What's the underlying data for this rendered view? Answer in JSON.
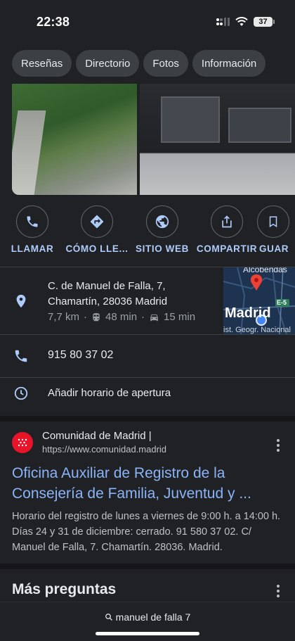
{
  "status": {
    "time": "22:38",
    "battery": "37"
  },
  "chips": [
    "Reseñas",
    "Directorio",
    "Fotos",
    "Información"
  ],
  "actions": [
    {
      "label": "LLAMAR",
      "icon": "phone-icon"
    },
    {
      "label": "CÓMO LLE...",
      "icon": "directions-icon"
    },
    {
      "label": "SITIO WEB",
      "icon": "globe-icon"
    },
    {
      "label": "COMPARTIR",
      "icon": "share-icon"
    },
    {
      "label": "GUAR",
      "icon": "bookmark-icon"
    }
  ],
  "address": {
    "line1": "C. de Manuel de Falla, 7,",
    "line2": "Chamartín, 28036 Madrid",
    "distance": "7,7 km",
    "transit_time": "48 min",
    "drive_time": "15 min"
  },
  "map": {
    "city_label": "Madrid",
    "top_label": "Alcobendas",
    "road_label": "E-5",
    "bottom_label": "ist. Geogr. Nacional"
  },
  "phone": "915 80 37 02",
  "hours_prompt": "Añadir horario de apertura",
  "result": {
    "source_name": "Comunidad de Madrid |",
    "source_url": "https://www.comunidad.madrid",
    "title": "Oficina Auxiliar de Registro de la Consejería de Familia, Juventud y ...",
    "snippet": "Horario del registro de lunes a viernes de 9:00 h. a 14:00 h. Días 24 y 31 de diciembre: cerrado. 91 580 37 02. C/ Manuel de Falla, 7. Chamartín. 28036. Madrid."
  },
  "section_title": "Más preguntas",
  "search_query": "manuel de falla 7",
  "colors": {
    "background": "#202124",
    "accent": "#aecbfa",
    "link": "#8ab4f8",
    "chip": "#3c4043",
    "brand_red": "#e8152a"
  }
}
